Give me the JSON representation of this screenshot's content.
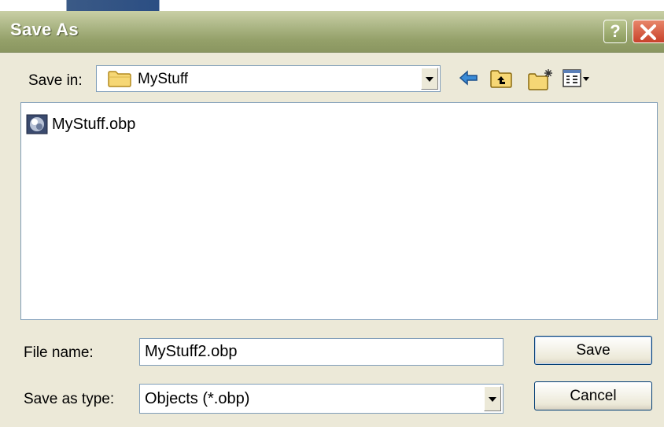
{
  "dialog": {
    "title": "Save As",
    "help_glyph": "?"
  },
  "toolbar": {
    "save_in_label": "Save in:",
    "save_in_value": "MyStuff",
    "icons": [
      "back-arrow-icon",
      "up-one-level-icon",
      "new-folder-icon",
      "views-menu-icon"
    ]
  },
  "file_list": {
    "items": [
      {
        "name": "MyStuff.obp",
        "icon": "obp-file-icon"
      }
    ]
  },
  "form": {
    "file_name_label": "File name:",
    "file_name_value": "MyStuff2.obp",
    "save_as_type_label": "Save as type:",
    "save_as_type_value": "Objects (*.obp)"
  },
  "buttons": {
    "save": "Save",
    "cancel": "Cancel"
  },
  "colors": {
    "titlebar": "#aeb888",
    "dialog_bg": "#ece9d8",
    "close_button": "#c8412a",
    "input_border": "#7f9db9"
  }
}
